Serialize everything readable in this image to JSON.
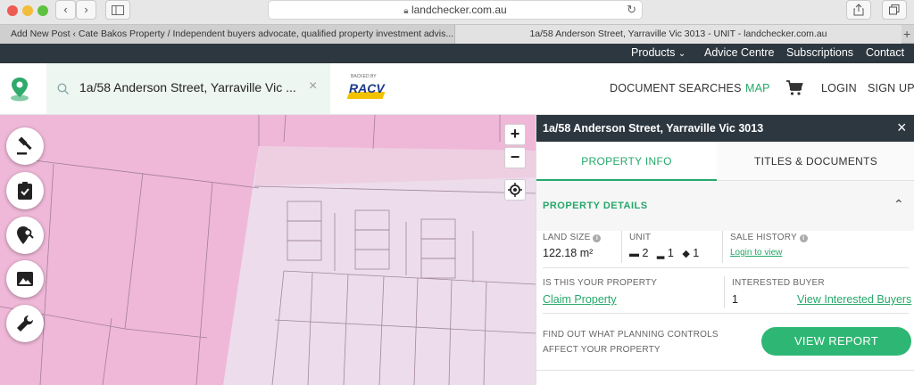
{
  "browser": {
    "url": "landchecker.com.au",
    "tabs": [
      {
        "label": "Add New Post ‹ Cate Bakos Property / Independent buyers advocate, qualified property investment advis...",
        "active": false
      },
      {
        "label": "1a/58 Anderson Street, Yarraville Vic 3013 - UNIT - landchecker.com.au",
        "active": true
      }
    ],
    "new_tab": "+"
  },
  "topbar": {
    "products": "Products",
    "advice": "Advice Centre",
    "subscriptions": "Subscriptions",
    "contact": "Contact"
  },
  "header": {
    "search_value": "1a/58 Anderson Street, Yarraville Vic ...",
    "racv_backed": "BACKED BY",
    "racv": "RACV",
    "document_searches": "DOCUMENT SEARCHES",
    "map": "MAP",
    "login": "LOGIN",
    "signup": "SIGN UP"
  },
  "map_controls": {
    "zoom_in": "+",
    "zoom_out": "−"
  },
  "panel": {
    "title": "1a/58 Anderson Street, Yarraville Vic 3013",
    "tabs": [
      "PROPERTY INFO",
      "TITLES & DOCUMENTS"
    ],
    "section_title": "PROPERTY DETAILS",
    "land_size_label": "LAND SIZE",
    "land_size_value": "122.18 m²",
    "unit_label": "UNIT",
    "beds": "2",
    "baths": "1",
    "cars": "1",
    "sale_history_label": "SALE HISTORY",
    "sale_history_link": "Login to view",
    "is_your_property_label": "IS THIS YOUR PROPERTY",
    "claim_link": "Claim Property",
    "interested_buyer_label": "INTERESTED BUYER",
    "interested_count": "1",
    "view_buyers_link": "View Interested Buyers",
    "planning_line1": "FIND OUT WHAT PLANNING CONTROLS",
    "planning_line2": "AFFECT YOUR PROPERTY",
    "view_report": "VIEW REPORT"
  },
  "colors": {
    "accent_green": "#26a86a",
    "dark_bar": "#2d3740",
    "map_pink": "#efb8d8",
    "map_lilac": "#ecdcec"
  }
}
